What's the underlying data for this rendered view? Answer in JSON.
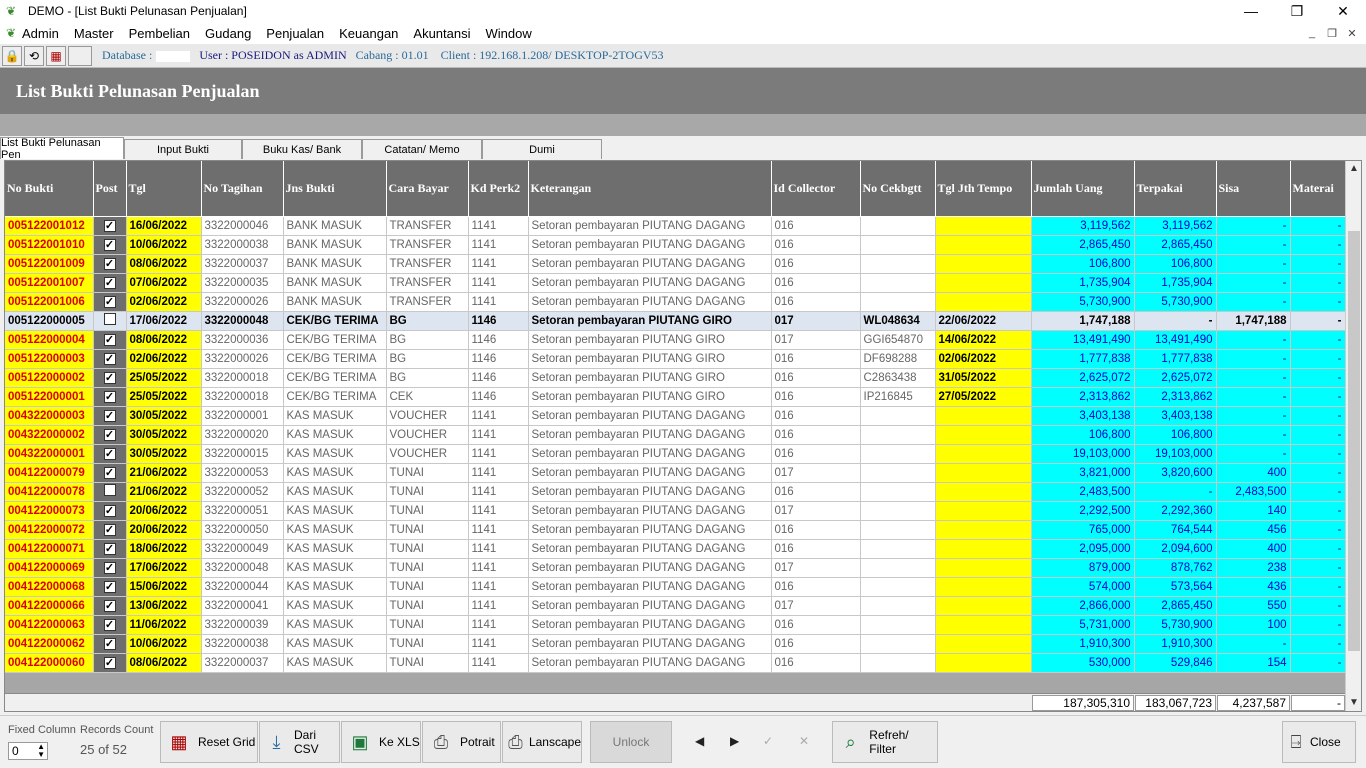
{
  "window": {
    "title": "DEMO - [List Bukti Pelunasan Penjualan]"
  },
  "menu": [
    "Admin",
    "Master",
    "Pembelian",
    "Gudang",
    "Penjualan",
    "Keuangan",
    "Akuntansi",
    "Window"
  ],
  "status": {
    "database_label": "Database :",
    "user": "User : POSEIDON as ADMIN",
    "cabang": "Cabang : 01.01",
    "client": "Client : 192.168.1.208/ DESKTOP-2TOGV53"
  },
  "header": {
    "title": "List Bukti Pelunasan Penjualan"
  },
  "tabs": [
    "List Bukti Pelunasan Pen",
    "Input Bukti",
    "Buku Kas/ Bank",
    "Catatan/ Memo",
    "Dumi"
  ],
  "columns": [
    "No Bukti",
    "Post",
    "Tgl",
    "No Tagihan",
    "Jns Bukti",
    "Cara Bayar",
    "Kd Perk2",
    "Keterangan",
    "Id Collector",
    "No Cekbgtt",
    "Tgl Jth Tempo",
    "Jumlah Uang",
    "Terpakai",
    "Sisa",
    "Materai"
  ],
  "rows": [
    [
      "005122001012",
      true,
      "16/06/2022",
      "3322000046",
      "BANK MASUK",
      "TRANSFER",
      "1141",
      "Setoran pembayaran PIUTANG DAGANG",
      "016",
      "",
      "",
      "3,119,562",
      "3,119,562",
      "-",
      "-"
    ],
    [
      "005122001010",
      true,
      "10/06/2022",
      "3322000038",
      "BANK MASUK",
      "TRANSFER",
      "1141",
      "Setoran pembayaran PIUTANG DAGANG",
      "016",
      "",
      "",
      "2,865,450",
      "2,865,450",
      "-",
      "-"
    ],
    [
      "005122001009",
      true,
      "08/06/2022",
      "3322000037",
      "BANK MASUK",
      "TRANSFER",
      "1141",
      "Setoran pembayaran PIUTANG DAGANG",
      "016",
      "",
      "",
      "106,800",
      "106,800",
      "-",
      "-"
    ],
    [
      "005122001007",
      true,
      "07/06/2022",
      "3322000035",
      "BANK MASUK",
      "TRANSFER",
      "1141",
      "Setoran pembayaran PIUTANG DAGANG",
      "016",
      "",
      "",
      "1,735,904",
      "1,735,904",
      "-",
      "-"
    ],
    [
      "005122001006",
      true,
      "02/06/2022",
      "3322000026",
      "BANK MASUK",
      "TRANSFER",
      "1141",
      "Setoran pembayaran PIUTANG DAGANG",
      "016",
      "",
      "",
      "5,730,900",
      "5,730,900",
      "-",
      "-"
    ],
    [
      "005122000005",
      false,
      "17/06/2022",
      "3322000048",
      "CEK/BG TERIMA",
      "BG",
      "1146",
      "Setoran pembayaran PIUTANG GIRO",
      "017",
      "WL048634",
      "22/06/2022",
      "1,747,188",
      "-",
      "1,747,188",
      "-"
    ],
    [
      "005122000004",
      true,
      "08/06/2022",
      "3322000036",
      "CEK/BG TERIMA",
      "BG",
      "1146",
      "Setoran pembayaran PIUTANG GIRO",
      "017",
      "GGI654870",
      "14/06/2022",
      "13,491,490",
      "13,491,490",
      "-",
      "-"
    ],
    [
      "005122000003",
      true,
      "02/06/2022",
      "3322000026",
      "CEK/BG TERIMA",
      "BG",
      "1146",
      "Setoran pembayaran PIUTANG GIRO",
      "016",
      "DF698288",
      "02/06/2022",
      "1,777,838",
      "1,777,838",
      "-",
      "-"
    ],
    [
      "005122000002",
      true,
      "25/05/2022",
      "3322000018",
      "CEK/BG TERIMA",
      "BG",
      "1146",
      "Setoran pembayaran PIUTANG GIRO",
      "016",
      "C2863438",
      "31/05/2022",
      "2,625,072",
      "2,625,072",
      "-",
      "-"
    ],
    [
      "005122000001",
      true,
      "25/05/2022",
      "3322000018",
      "CEK/BG TERIMA",
      "CEK",
      "1146",
      "Setoran pembayaran PIUTANG GIRO",
      "016",
      "IP216845",
      "27/05/2022",
      "2,313,862",
      "2,313,862",
      "-",
      "-"
    ],
    [
      "004322000003",
      true,
      "30/05/2022",
      "3322000001",
      "KAS MASUK",
      "VOUCHER",
      "1141",
      "Setoran pembayaran PIUTANG DAGANG",
      "016",
      "",
      "",
      "3,403,138",
      "3,403,138",
      "-",
      "-"
    ],
    [
      "004322000002",
      true,
      "30/05/2022",
      "3322000020",
      "KAS MASUK",
      "VOUCHER",
      "1141",
      "Setoran pembayaran PIUTANG DAGANG",
      "016",
      "",
      "",
      "106,800",
      "106,800",
      "-",
      "-"
    ],
    [
      "004322000001",
      true,
      "30/05/2022",
      "3322000015",
      "KAS MASUK",
      "VOUCHER",
      "1141",
      "Setoran pembayaran PIUTANG DAGANG",
      "016",
      "",
      "",
      "19,103,000",
      "19,103,000",
      "-",
      "-"
    ],
    [
      "004122000079",
      true,
      "21/06/2022",
      "3322000053",
      "KAS MASUK",
      "TUNAI",
      "1141",
      "Setoran pembayaran PIUTANG DAGANG",
      "017",
      "",
      "",
      "3,821,000",
      "3,820,600",
      "400",
      "-"
    ],
    [
      "004122000078",
      false,
      "21/06/2022",
      "3322000052",
      "KAS MASUK",
      "TUNAI",
      "1141",
      "Setoran pembayaran PIUTANG DAGANG",
      "016",
      "",
      "",
      "2,483,500",
      "-",
      "2,483,500",
      "-"
    ],
    [
      "004122000073",
      true,
      "20/06/2022",
      "3322000051",
      "KAS MASUK",
      "TUNAI",
      "1141",
      "Setoran pembayaran PIUTANG DAGANG",
      "017",
      "",
      "",
      "2,292,500",
      "2,292,360",
      "140",
      "-"
    ],
    [
      "004122000072",
      true,
      "20/06/2022",
      "3322000050",
      "KAS MASUK",
      "TUNAI",
      "1141",
      "Setoran pembayaran PIUTANG DAGANG",
      "016",
      "",
      "",
      "765,000",
      "764,544",
      "456",
      "-"
    ],
    [
      "004122000071",
      true,
      "18/06/2022",
      "3322000049",
      "KAS MASUK",
      "TUNAI",
      "1141",
      "Setoran pembayaran PIUTANG DAGANG",
      "016",
      "",
      "",
      "2,095,000",
      "2,094,600",
      "400",
      "-"
    ],
    [
      "004122000069",
      true,
      "17/06/2022",
      "3322000048",
      "KAS MASUK",
      "TUNAI",
      "1141",
      "Setoran pembayaran PIUTANG DAGANG",
      "017",
      "",
      "",
      "879,000",
      "878,762",
      "238",
      "-"
    ],
    [
      "004122000068",
      true,
      "15/06/2022",
      "3322000044",
      "KAS MASUK",
      "TUNAI",
      "1141",
      "Setoran pembayaran PIUTANG DAGANG",
      "016",
      "",
      "",
      "574,000",
      "573,564",
      "436",
      "-"
    ],
    [
      "004122000066",
      true,
      "13/06/2022",
      "3322000041",
      "KAS MASUK",
      "TUNAI",
      "1141",
      "Setoran pembayaran PIUTANG DAGANG",
      "017",
      "",
      "",
      "2,866,000",
      "2,865,450",
      "550",
      "-"
    ],
    [
      "004122000063",
      true,
      "11/06/2022",
      "3322000039",
      "KAS MASUK",
      "TUNAI",
      "1141",
      "Setoran pembayaran PIUTANG DAGANG",
      "016",
      "",
      "",
      "5,731,000",
      "5,730,900",
      "100",
      "-"
    ],
    [
      "004122000062",
      true,
      "10/06/2022",
      "3322000038",
      "KAS MASUK",
      "TUNAI",
      "1141",
      "Setoran pembayaran PIUTANG DAGANG",
      "016",
      "",
      "",
      "1,910,300",
      "1,910,300",
      "-",
      "-"
    ],
    [
      "004122000060",
      true,
      "08/06/2022",
      "3322000037",
      "KAS MASUK",
      "TUNAI",
      "1141",
      "Setoran pembayaran PIUTANG DAGANG",
      "016",
      "",
      "",
      "530,000",
      "529,846",
      "154",
      "-"
    ]
  ],
  "selected_row": 5,
  "totals": {
    "jumlah": "187,305,310",
    "terpakai": "183,067,723",
    "sisa": "4,237,587",
    "materai": "-"
  },
  "bottom": {
    "fixed_column_label": "Fixed Column",
    "fixed_column_value": "0",
    "records_label": "Records Count",
    "records_value": "25 of 52",
    "reset_grid": "Reset Grid",
    "dari_csv": "Dari CSV",
    "ke_xls": "Ke XLS",
    "potrait": "Potrait",
    "lanscape": "Lanscape",
    "unlock": "Unlock",
    "refresh": "Refreh/ Filter",
    "close": "Close"
  }
}
